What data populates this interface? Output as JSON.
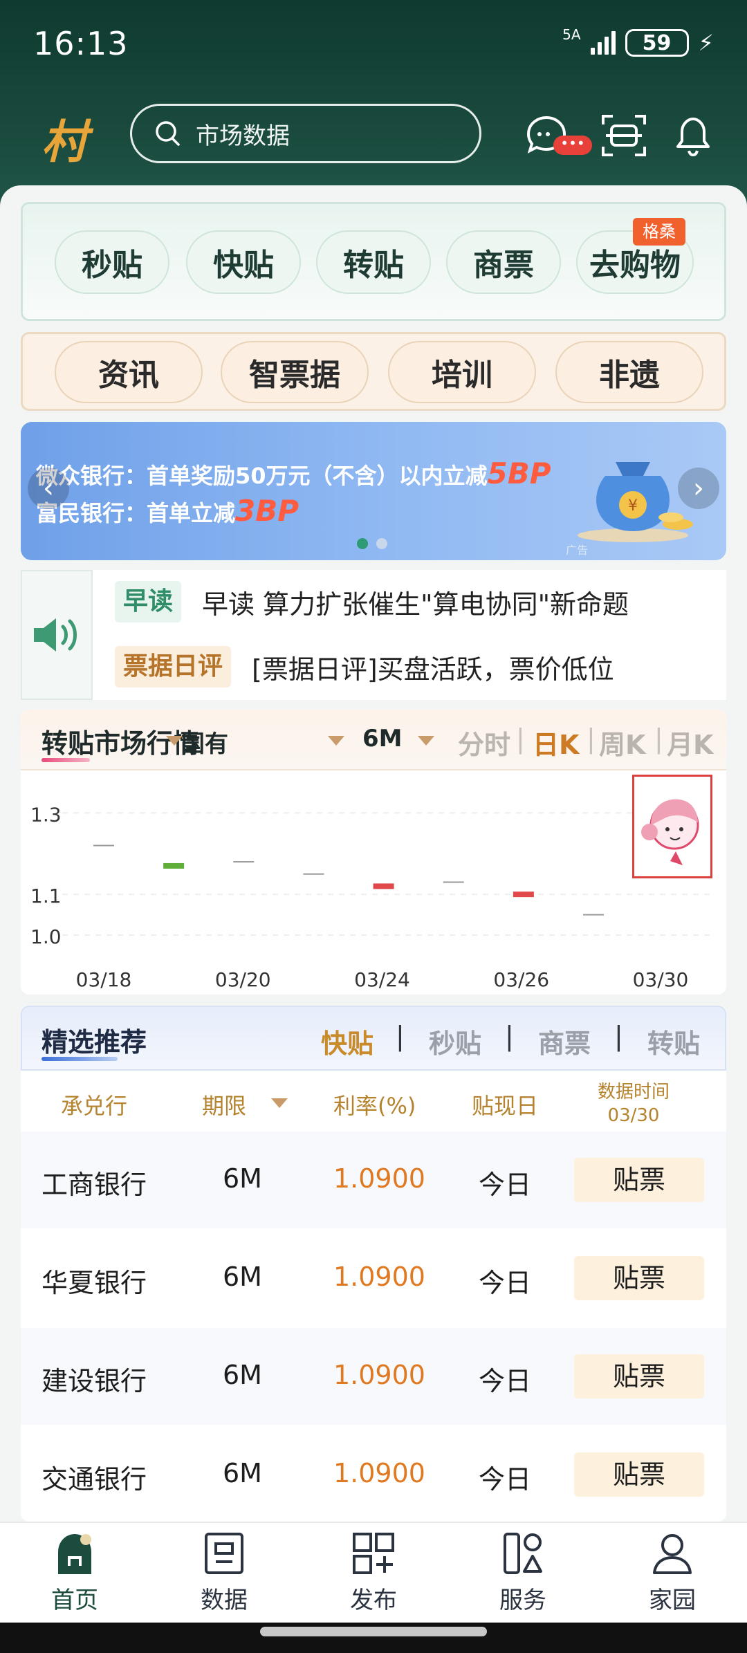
{
  "status": {
    "time": "16:13",
    "network": "5A",
    "battery": "59"
  },
  "header": {
    "logo": "村",
    "search_placeholder": "市场数据"
  },
  "quick_pills": [
    "秒贴",
    "快贴",
    "转贴",
    "商票",
    "去购物"
  ],
  "quick_tag": "格桑",
  "info_pills": [
    "资讯",
    "智票据",
    "培训",
    "非遗"
  ],
  "banner": {
    "line1_prefix": "微众银行：首单奖励50万元（不含）以内立减",
    "line1_highlight": "5BP",
    "line2_prefix": "富民银行：首单立减",
    "line2_highlight": "3BP",
    "ad_label": "广告"
  },
  "news": [
    {
      "tag": "早读",
      "text": "早读 算力扩张催生\"算电协同\"新命题"
    },
    {
      "tag": "票据日评",
      "text": "[票据日评]买盘活跃，票价低位"
    }
  ],
  "market": {
    "title": "转贴市场行情",
    "filter_type": "国有",
    "filter_term": "6M",
    "periods": [
      "分时",
      "日K",
      "周K",
      "月K"
    ],
    "active_period": "日K"
  },
  "chart_data": {
    "type": "candlestick",
    "y_ticks": [
      "1.3",
      "1.1",
      "1.0"
    ],
    "ylim": [
      1.0,
      1.35
    ],
    "x_ticks": [
      "03/18",
      "03/20",
      "03/24",
      "03/26",
      "03/30"
    ],
    "candles": [
      {
        "value": 1.22,
        "color": "#999999"
      },
      {
        "value": 1.17,
        "color": "#5fae3a"
      },
      {
        "value": 1.18,
        "color": "#999999"
      },
      {
        "value": 1.15,
        "color": "#999999"
      },
      {
        "value": 1.12,
        "color": "#e0484a"
      },
      {
        "value": 1.13,
        "color": "#999999"
      },
      {
        "value": 1.1,
        "color": "#e0484a"
      },
      {
        "value": 1.05,
        "color": "#999999"
      }
    ]
  },
  "recs": {
    "title": "精选推荐",
    "tabs": [
      "快贴",
      "秒贴",
      "商票",
      "转贴"
    ],
    "active_tab": "快贴",
    "columns": {
      "bank": "承兑行",
      "term": "期限",
      "rate": "利率(%)",
      "day": "贴现日",
      "time_label": "数据时间",
      "time_value": "03/30"
    },
    "rows": [
      {
        "bank": "工商银行",
        "term": "6M",
        "rate": "1.0900",
        "day": "今日",
        "action": "贴票"
      },
      {
        "bank": "华夏银行",
        "term": "6M",
        "rate": "1.0900",
        "day": "今日",
        "action": "贴票"
      },
      {
        "bank": "建设银行",
        "term": "6M",
        "rate": "1.0900",
        "day": "今日",
        "action": "贴票"
      },
      {
        "bank": "交通银行",
        "term": "6M",
        "rate": "1.0900",
        "day": "今日",
        "action": "贴票"
      }
    ]
  },
  "tabbar": {
    "items": [
      "首页",
      "数据",
      "发布",
      "服务",
      "家园"
    ],
    "active": "首页"
  },
  "colors": {
    "brand_dark": "#1a4b3e",
    "accent_orange": "#e07a22",
    "accent_gold": "#b5822e"
  },
  "icons": [
    "search-icon",
    "chat-icon",
    "scan-icon",
    "bell-icon",
    "speaker-icon",
    "home-icon",
    "data-icon",
    "publish-icon",
    "service-icon",
    "user-icon"
  ]
}
